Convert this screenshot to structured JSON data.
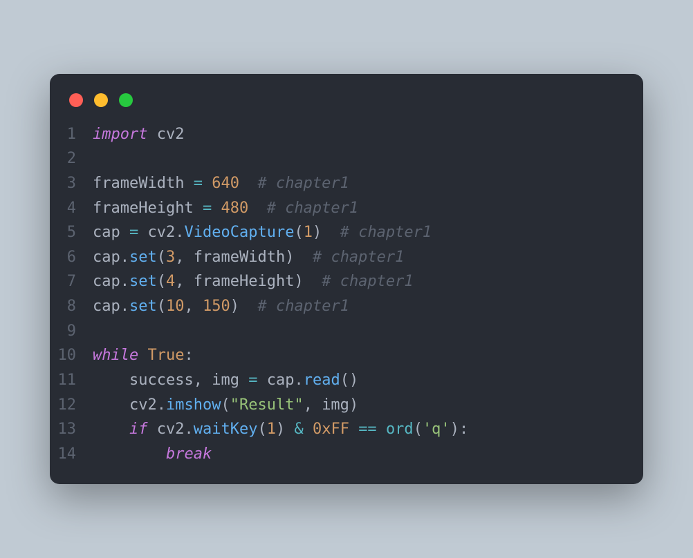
{
  "titlebar": {
    "buttons": [
      "close",
      "minimize",
      "zoom"
    ]
  },
  "linenos": [
    "1",
    "2",
    "3",
    "4",
    "5",
    "6",
    "7",
    "8",
    "9",
    "10",
    "11",
    "12",
    "13",
    "14"
  ],
  "code": {
    "l1": {
      "import": "import",
      "module": "cv2"
    },
    "l3": {
      "var": "frameWidth",
      "eq": "=",
      "val": "640",
      "comment": "# chapter1"
    },
    "l4": {
      "var": "frameHeight",
      "eq": "=",
      "val": "480",
      "comment": "# chapter1"
    },
    "l5": {
      "var": "cap",
      "eq": "=",
      "obj": "cv2",
      "dot": ".",
      "fn": "VideoCapture",
      "lp": "(",
      "arg": "1",
      "rp": ")",
      "comment": "# chapter1"
    },
    "l6": {
      "obj": "cap",
      "dot": ".",
      "fn": "set",
      "lp": "(",
      "a1": "3",
      "comma": ", ",
      "a2": "frameWidth",
      "rp": ")",
      "comment": "# chapter1"
    },
    "l7": {
      "obj": "cap",
      "dot": ".",
      "fn": "set",
      "lp": "(",
      "a1": "4",
      "comma": ", ",
      "a2": "frameHeight",
      "rp": ")",
      "comment": "# chapter1"
    },
    "l8": {
      "obj": "cap",
      "dot": ".",
      "fn": "set",
      "lp": "(",
      "a1": "10",
      "comma": ", ",
      "a2": "150",
      "rp": ")",
      "comment": "# chapter1"
    },
    "l10": {
      "while": "while",
      "true": "True",
      "colon": ":"
    },
    "l11": {
      "a": "success",
      "comma": ", ",
      "b": "img",
      "eq": "=",
      "obj": "cap",
      "dot": ".",
      "fn": "read",
      "lp": "(",
      "rp": ")"
    },
    "l12": {
      "obj": "cv2",
      "dot": ".",
      "fn": "imshow",
      "lp": "(",
      "str": "\"Result\"",
      "comma": ", ",
      "arg": "img",
      "rp": ")"
    },
    "l13": {
      "if": "if",
      "obj": "cv2",
      "dot": ".",
      "fn": "waitKey",
      "lp": "(",
      "arg": "1",
      "rp": ")",
      "amp": "&",
      "hex": "0xFF",
      "eqeq": "==",
      "ord": "ord",
      "lp2": "(",
      "str": "'q'",
      "rp2": ")",
      "colon": ":"
    },
    "l14": {
      "break": "break"
    }
  }
}
